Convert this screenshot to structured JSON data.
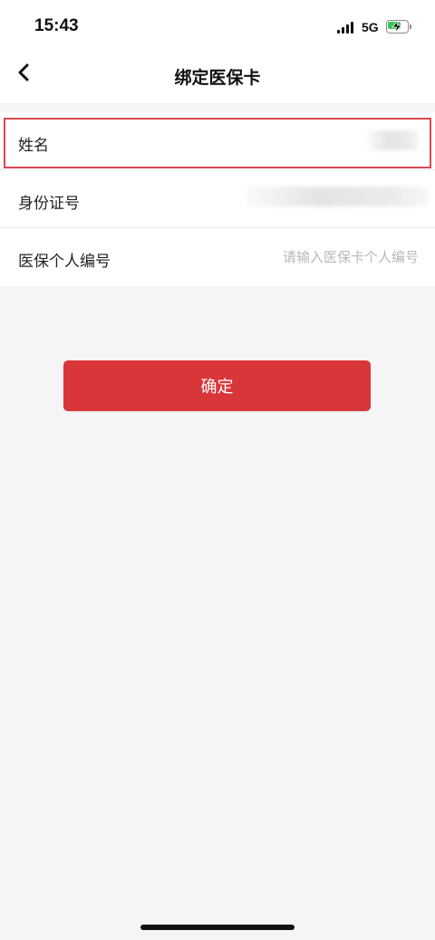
{
  "status_bar": {
    "time": "15:43",
    "network": "5G",
    "battery_level": 0.55,
    "battery_color": "#35c759",
    "icons": [
      "signal-icon",
      "battery-charging-icon"
    ]
  },
  "nav": {
    "title": "绑定医保卡",
    "back_icon": "chevron-left-icon"
  },
  "form": {
    "name_label": "姓名",
    "name_value": "",
    "id_label": "身份证号",
    "id_value": "",
    "insurance_no_label": "医保个人编号",
    "insurance_no_placeholder": "请输入医保卡个人编号",
    "insurance_no_value": ""
  },
  "actions": {
    "confirm_label": "确定"
  },
  "colors": {
    "accent": "#d9363a",
    "highlight_border": "#d9484f",
    "background": "#f5f5f7"
  }
}
